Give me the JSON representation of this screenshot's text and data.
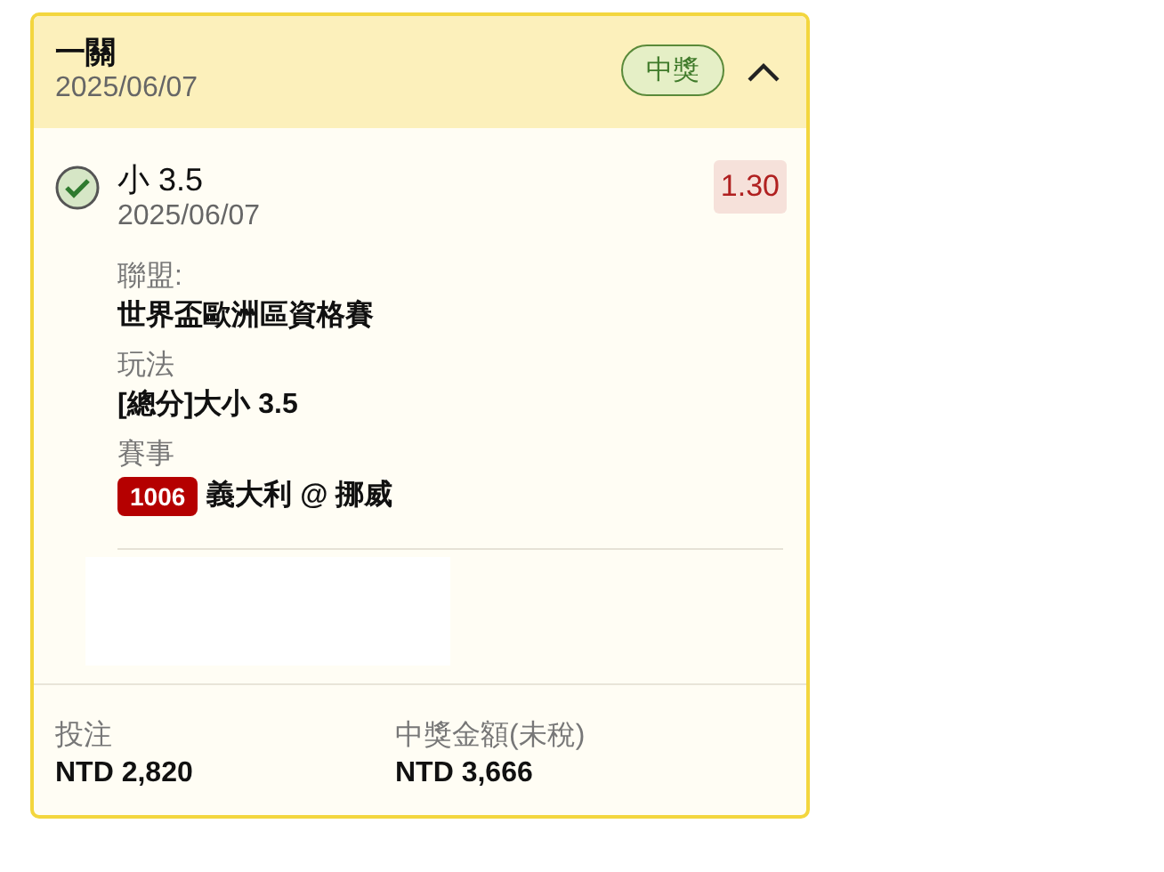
{
  "bet": {
    "title": "一關",
    "date": "2025/06/07",
    "status": "中獎",
    "kind": "won",
    "expanded": true
  },
  "legs": [
    {
      "won": true,
      "selection": "小 3.5",
      "date": "2025/06/07",
      "odds": "1.30",
      "league_label": "聯盟:",
      "league": "世界盃歐洲區資格賽",
      "market_label": "玩法",
      "market": "[總分]大小 3.5",
      "match_label": "賽事",
      "match_no": "1006",
      "match": "義大利 @ 挪威"
    }
  ],
  "footer": [
    {
      "label": "投注",
      "value": "NTD 2,820"
    },
    {
      "label": "中獎金額(未稅)",
      "value": "NTD 3,666"
    }
  ]
}
